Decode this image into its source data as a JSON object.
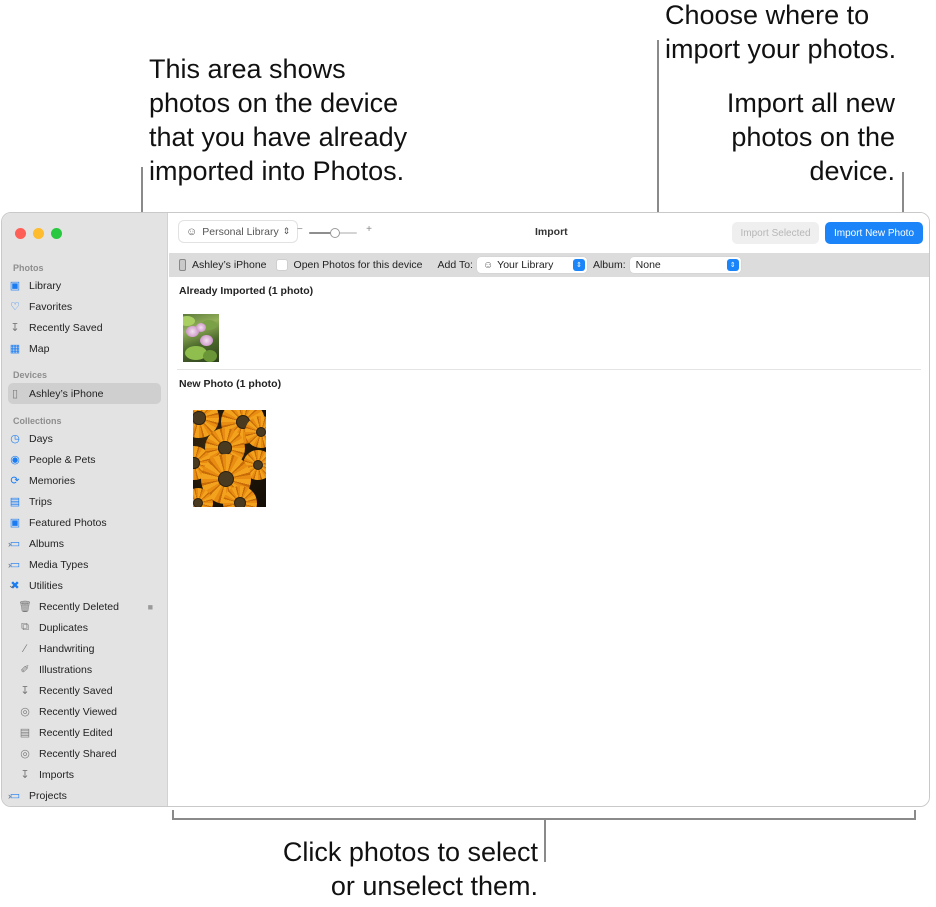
{
  "callouts": {
    "already_imported": [
      "This area shows",
      "photos on the device",
      "that you have already",
      "imported into Photos."
    ],
    "choose_where": [
      "Choose where to",
      "import your photos."
    ],
    "import_all": [
      "Import all new",
      "photos on the",
      "device."
    ],
    "click_photos": [
      "Click photos to select",
      "or unselect them."
    ]
  },
  "window": {
    "title": "Import",
    "toolbar": {
      "library_picker": "Personal Library",
      "zoom_slider": {
        "min_label": "−",
        "max_label": "+",
        "value": 0.55
      },
      "import_selected_label": "Import Selected",
      "import_selected_enabled": false,
      "import_new_label": "Import New Photo"
    },
    "device_bar": {
      "device_name": "Ashley’s iPhone",
      "open_photos_label": "Open Photos for this device",
      "open_photos_checked": false,
      "add_to_label": "Add To:",
      "add_to_value": "Your Library",
      "album_label": "Album:",
      "album_value": "None"
    },
    "sections": [
      {
        "title": "Already Imported (1 photo)",
        "photos": [
          {
            "subject": "pink cosmos flowers"
          }
        ]
      },
      {
        "title": "New Photo (1 photo)",
        "photos": [
          {
            "subject": "orange black-eyed susans"
          }
        ]
      }
    ]
  },
  "sidebar": {
    "sections": {
      "photos": "Photos",
      "devices": "Devices",
      "collections": "Collections"
    },
    "photos_items": [
      {
        "label": "Library",
        "icon": "photo-library-icon"
      },
      {
        "label": "Favorites",
        "icon": "heart-icon"
      },
      {
        "label": "Recently Saved",
        "icon": "tray-download-icon"
      },
      {
        "label": "Map",
        "icon": "map-icon"
      }
    ],
    "device_items": [
      {
        "label": "Ashley’s iPhone",
        "icon": "iphone-icon",
        "selected": true
      }
    ],
    "collection_items": [
      {
        "label": "Days",
        "icon": "clock-icon"
      },
      {
        "label": "People & Pets",
        "icon": "person-circle-icon"
      },
      {
        "label": "Memories",
        "icon": "memories-icon"
      },
      {
        "label": "Trips",
        "icon": "suitcase-icon"
      },
      {
        "label": "Featured Photos",
        "icon": "featured-photo-icon"
      },
      {
        "label": "Albums",
        "icon": "folder-stack-icon",
        "disclosure": "collapsed"
      },
      {
        "label": "Media Types",
        "icon": "folder-stack-icon",
        "disclosure": "collapsed"
      },
      {
        "label": "Utilities",
        "icon": "tools-icon",
        "disclosure": "expanded"
      }
    ],
    "utility_items": [
      {
        "label": "Recently Deleted",
        "icon": "trash-icon",
        "locked": true
      },
      {
        "label": "Duplicates",
        "icon": "duplicates-icon"
      },
      {
        "label": "Handwriting",
        "icon": "pen-stroke-icon"
      },
      {
        "label": "Illustrations",
        "icon": "illustration-icon"
      },
      {
        "label": "Recently Saved",
        "icon": "tray-download-icon"
      },
      {
        "label": "Recently Viewed",
        "icon": "eye-icon"
      },
      {
        "label": "Recently Edited",
        "icon": "edit-doc-icon"
      },
      {
        "label": "Recently Shared",
        "icon": "shared-icon"
      },
      {
        "label": "Imports",
        "icon": "tray-download-icon"
      }
    ],
    "bottom_items": [
      {
        "label": "Projects",
        "icon": "folder-stack-icon",
        "disclosure": "collapsed"
      }
    ]
  }
}
